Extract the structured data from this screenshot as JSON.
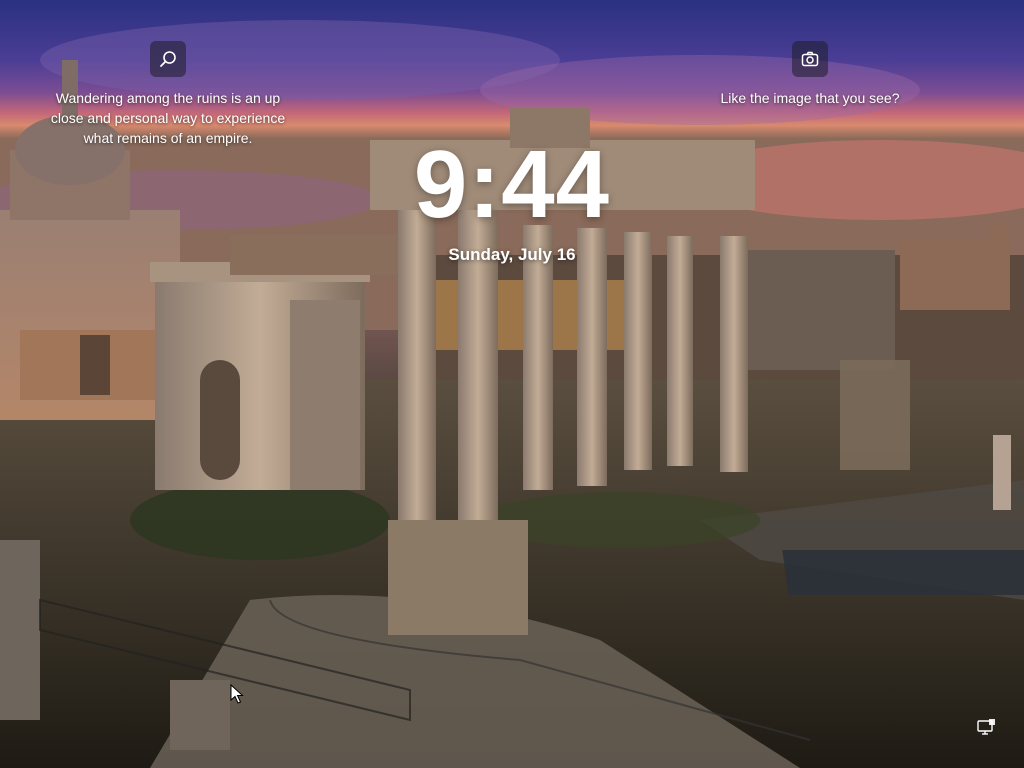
{
  "lockscreen": {
    "time": "9:44",
    "date": "Sunday, July 16",
    "spotlight_caption": "Wandering among the ruins is an up close and personal way to experience what remains of an empire.",
    "like_prompt": "Like the image that you see?",
    "icons": {
      "search": "search-icon",
      "camera": "camera-icon",
      "network": "network-icon"
    }
  }
}
